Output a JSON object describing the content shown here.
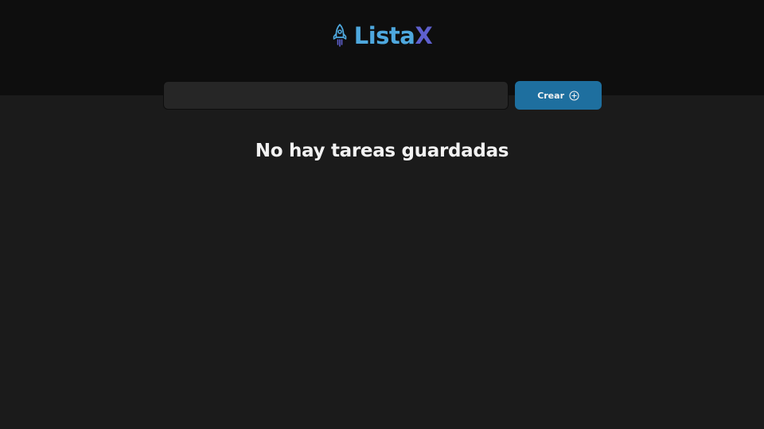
{
  "header": {
    "logo_icon": "rocket-icon",
    "logo_text_part1": "Lista",
    "logo_text_part2": "X",
    "colors": {
      "background": "#0e0e0e",
      "blue": "#4ea8de",
      "purple": "#5e60ce"
    }
  },
  "form": {
    "input_value": "",
    "input_placeholder": "",
    "create_label": "Crear",
    "create_icon": "plus-circle-icon",
    "button_color": "#1e6f9f"
  },
  "tasks": {
    "empty_message": "No hay tareas guardadas"
  }
}
